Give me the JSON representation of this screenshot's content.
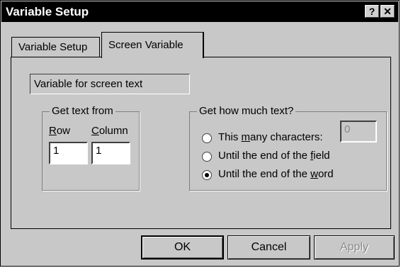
{
  "window": {
    "title": "Variable Setup",
    "help_label": "?",
    "close_label": "✕"
  },
  "tabs": [
    {
      "label": "Variable Setup",
      "selected": false
    },
    {
      "label": "Screen Variable",
      "selected": true
    }
  ],
  "variable_field": {
    "value": "Variable for screen text"
  },
  "get_text_from": {
    "legend": "Get text from",
    "row_label_first": "R",
    "row_label_rest": "ow",
    "column_label_first": "C",
    "column_label_rest": "olumn",
    "row_value": "1",
    "column_value": "1"
  },
  "how_much": {
    "legend": "Get how much text?",
    "options": [
      {
        "pre": "This ",
        "key": "m",
        "post": "any characters:",
        "selected": false
      },
      {
        "pre": "Until the end of the ",
        "key": "f",
        "post": "ield",
        "selected": false
      },
      {
        "pre": "Until the end of the ",
        "key": "w",
        "post": "ord",
        "selected": true
      }
    ],
    "char_count_value": "0"
  },
  "buttons": {
    "ok": "OK",
    "cancel": "Cancel",
    "apply": "Apply"
  }
}
